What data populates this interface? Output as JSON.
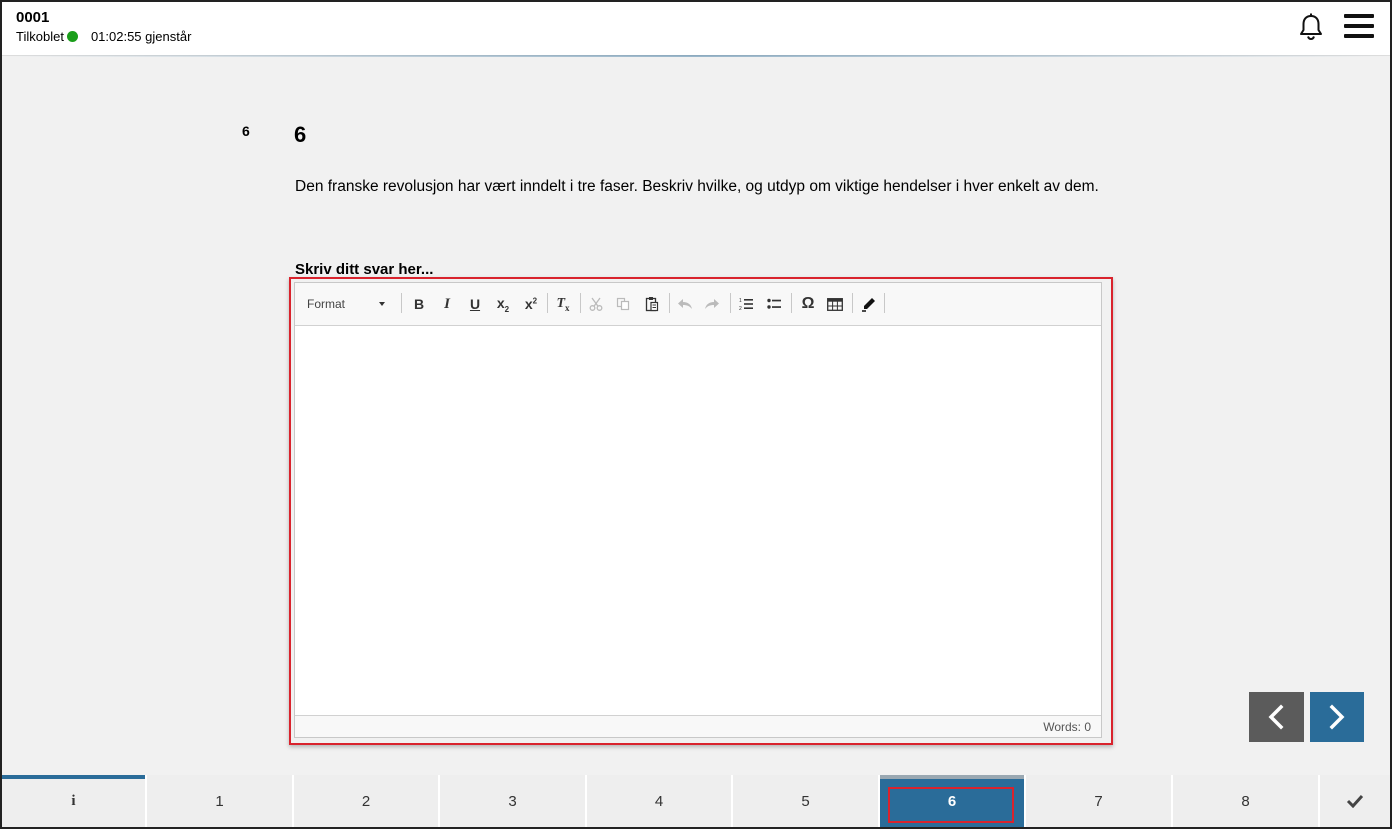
{
  "header": {
    "candidate_id": "0001",
    "connection_status": "Tilkoblet",
    "time_remaining": "01:02:55 gjenstår",
    "icons": {
      "notifications": "bell-icon",
      "menu": "hamburger-menu-icon"
    },
    "status_color": "#1a9e1a"
  },
  "question": {
    "number_small": "6",
    "number_title": "6",
    "text": "Den franske revolusjon har vært inndelt i tre faser. Beskriv hvilke, og utdyp om viktige hendelser i hver enkelt av dem.",
    "answer_label": "Skriv ditt svar her..."
  },
  "editor": {
    "format_label": "Format",
    "toolbar_icons": [
      "bold-icon",
      "italic-icon",
      "underline-icon",
      "subscript-icon",
      "superscript-icon",
      "remove-format-icon",
      "cut-icon",
      "copy-icon",
      "paste-icon",
      "undo-icon",
      "redo-icon",
      "numbered-list-icon",
      "bulleted-list-icon",
      "special-character-icon",
      "table-icon",
      "highlighter-icon"
    ],
    "content": "",
    "word_count": "Words: 0"
  },
  "navigation": {
    "prev_icon": "chevron-left-icon",
    "next_icon": "chevron-right-icon"
  },
  "bottom_tabs": {
    "info_icon": "info-icon",
    "items": [
      "1",
      "2",
      "3",
      "4",
      "5",
      "6",
      "7",
      "8"
    ],
    "active": "6",
    "submit_icon": "check-icon"
  },
  "colors": {
    "accent": "#2a6c99",
    "highlight": "#d9232d",
    "prev_button": "#5b5b5b"
  }
}
